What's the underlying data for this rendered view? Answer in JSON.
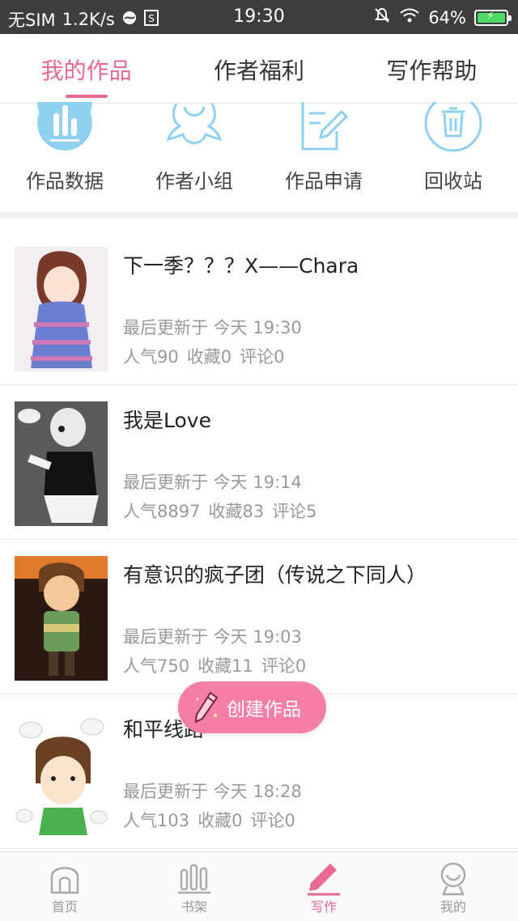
{
  "status_bar": {
    "carrier": "无SIM",
    "speed": "1.2K/s",
    "time": "19:30",
    "battery": "64%"
  },
  "top_tabs": [
    {
      "label": "我的作品",
      "active": true
    },
    {
      "label": "作者福利",
      "active": false
    },
    {
      "label": "写作帮助",
      "active": false
    }
  ],
  "shortcuts": [
    {
      "label": "作品数据",
      "icon": "bar-chart-icon"
    },
    {
      "label": "作者小组",
      "icon": "group-icon"
    },
    {
      "label": "作品申请",
      "icon": "edit-document-icon"
    },
    {
      "label": "回收站",
      "icon": "trash-icon"
    }
  ],
  "works": [
    {
      "title": "下一季？？？X——Chara",
      "updated": "最后更新于 今天 19:30",
      "popularity": "人气90",
      "favorites": "收藏0",
      "comments": "评论0"
    },
    {
      "title": "我是Love",
      "updated": "最后更新于 今天 19:14",
      "popularity": "人气8897",
      "favorites": "收藏83",
      "comments": "评论5"
    },
    {
      "title": "有意识的疯子团（传说之下同人）",
      "updated": "最后更新于 今天 19:03",
      "popularity": "人气750",
      "favorites": "收藏11",
      "comments": "评论0"
    },
    {
      "title": "和平线路",
      "updated": "最后更新于 今天 18:28",
      "popularity": "人气103",
      "favorites": "收藏0",
      "comments": "评论0"
    }
  ],
  "fab": {
    "label": "创建作品",
    "icon": "pencil-icon"
  },
  "bottom_nav": [
    {
      "label": "首页",
      "icon": "home-icon",
      "active": false
    },
    {
      "label": "书架",
      "icon": "bookshelf-icon",
      "active": false
    },
    {
      "label": "写作",
      "icon": "pencil-icon",
      "active": true
    },
    {
      "label": "我的",
      "icon": "profile-icon",
      "active": false
    }
  ],
  "colors": {
    "accent": "#e86a8e",
    "fab": "#f57fa8",
    "icon_blue": "#8fd0f0"
  }
}
